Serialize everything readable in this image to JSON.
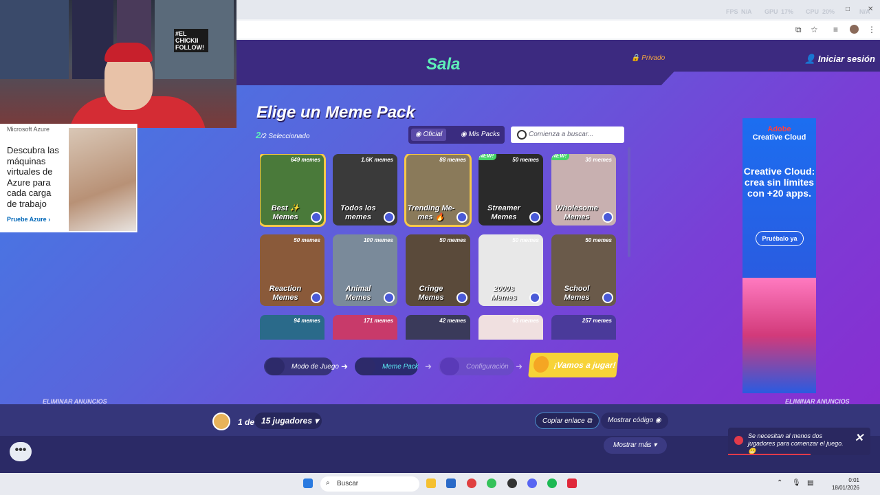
{
  "browser": {
    "perf": {
      "fps_label": "FPS",
      "fps": "N/A",
      "gpu_label": "GPU",
      "gpu": "17%",
      "cpu_label": "CPU",
      "cpu": "20%",
      "ram": "N/A"
    }
  },
  "game": {
    "header": {
      "title": "Sala",
      "privacy": "Privado",
      "login": "Iniciar sesión"
    },
    "page_title": "Elige un Meme Pack",
    "selected": {
      "count": "2",
      "text": "/2 Seleccionado"
    },
    "tabs": [
      {
        "label": "Oficial"
      },
      {
        "label": "Mis Packs"
      }
    ],
    "search_placeholder": "Comienza a buscar...",
    "packs": [
      {
        "name": "Best ✨ Memes",
        "count": "649 memes",
        "selected": true,
        "new": false,
        "bg": "#4a7a3a"
      },
      {
        "name": "Todos los memes",
        "count": "1.6K memes",
        "selected": false,
        "new": false,
        "bg": "#3a3a3a"
      },
      {
        "name": "Trending Me-mes 🔥",
        "count": "88 memes",
        "selected": true,
        "new": false,
        "bg": "#8a7a5a"
      },
      {
        "name": "Streamer Memes",
        "count": "50 memes",
        "selected": false,
        "new": true,
        "bg": "#2a2a2a"
      },
      {
        "name": "Wholesome Memes",
        "count": "30 memes",
        "selected": false,
        "new": true,
        "bg": "#c8b0b0"
      },
      {
        "name": "Reaction Memes",
        "count": "50 memes",
        "selected": false,
        "new": false,
        "bg": "#8a5a3a"
      },
      {
        "name": "Animal Memes",
        "count": "100 memes",
        "selected": false,
        "new": false,
        "bg": "#7a8a9a"
      },
      {
        "name": "Cringe Memes",
        "count": "50 memes",
        "selected": false,
        "new": false,
        "bg": "#5a4a3a"
      },
      {
        "name": "2000s Memes",
        "count": "50 memes",
        "selected": false,
        "new": false,
        "bg": "#e8e8e8"
      },
      {
        "name": "School Memes",
        "count": "50 memes",
        "selected": false,
        "new": false,
        "bg": "#6a5a4a"
      },
      {
        "name": "",
        "count": "94 memes",
        "selected": false,
        "new": false,
        "bg": "#2a6a8a"
      },
      {
        "name": "",
        "count": "171 memes",
        "selected": false,
        "new": false,
        "bg": "#c83a6a"
      },
      {
        "name": "",
        "count": "42 memes",
        "selected": false,
        "new": false,
        "bg": "#3a3a5a"
      },
      {
        "name": "",
        "count": "63 memes",
        "selected": false,
        "new": false,
        "bg": "#f0e0e0"
      },
      {
        "name": "",
        "count": "257 memes",
        "selected": false,
        "new": false,
        "bg": "#4a3a9a"
      }
    ],
    "new_badge": "NEW!",
    "steps": [
      {
        "label": "Modo de Juego"
      },
      {
        "label": "Meme Pack"
      },
      {
        "label": "Configuración"
      }
    ],
    "play_button": "¡Vamos a jugar!",
    "remove_ads": "ELIMINAR ANUNCIOS",
    "bottom": {
      "players_of": "1 de",
      "players_select": "15 jugadores",
      "copy_link": "Copiar enlace",
      "show_code": "Mostrar código",
      "show_more": "Mostrar más"
    },
    "toast": "Se necesitan al menos dos jugadores para comenzar el juego. 😬"
  },
  "webcam": {
    "sign": "#EL CHICKII FOLLOW!"
  },
  "ads": {
    "azure": {
      "brand": "Microsoft Azure",
      "copy": "Descubra las máquinas virtuales de Azure para cada carga de trabajo",
      "cta": "Pruebe Azure"
    },
    "adobe": {
      "brand": "Adobe",
      "product": "Creative Cloud",
      "headline": "Creative Cloud: crea sin límites con +20 apps.",
      "cta": "Pruébalo ya"
    }
  },
  "taskbar": {
    "search": "Buscar",
    "time": "0:01",
    "date": "18/01/2026"
  }
}
